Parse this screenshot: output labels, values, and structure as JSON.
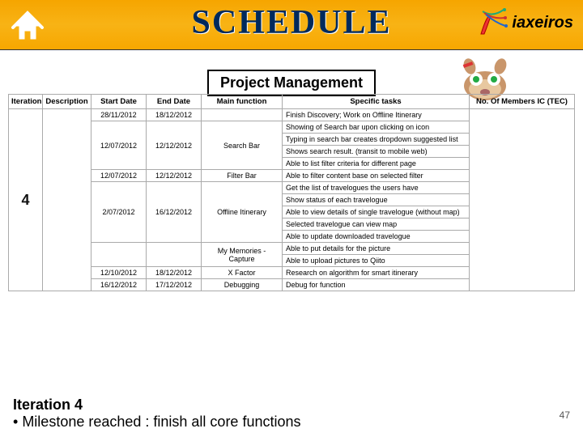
{
  "header": {
    "title": "SCHEDULE",
    "brand": "iaxeiros",
    "home_icon": "home-icon"
  },
  "callout": {
    "label": "Project Management"
  },
  "columns": {
    "iter": "Iteration",
    "desc": "Description",
    "start": "Start Date",
    "end": "End Date",
    "main": "Main function",
    "task": "Specific tasks",
    "mem": "No. Of Members IC (TEC)"
  },
  "iteration_number": "4",
  "rows": [
    {
      "start": "28/11/2012",
      "end": "18/12/2012",
      "main": "",
      "task": "Finish Discovery; Work on Offline Itinerary"
    },
    {
      "start": "12/07/2012",
      "end": "12/12/2012",
      "main": "Search Bar",
      "task": "Showing of Search bar upon clicking on icon",
      "main_span": 4
    },
    {
      "task": "Typing in search bar creates dropdown suggested list"
    },
    {
      "task": "Shows search result. (transit to mobile web)"
    },
    {
      "task": "Able to list filter criteria for different page"
    },
    {
      "start": "12/07/2012",
      "end": "12/12/2012",
      "main": "Filter Bar",
      "task": "Able to filter content base on selected filter",
      "main_span": 1
    },
    {
      "start": "2/07/2012",
      "end": "16/12/2012",
      "main": "Offline Itinerary",
      "task": "Get the list of travelogues the users have",
      "main_span": 5
    },
    {
      "task": "Show status of each travelogue"
    },
    {
      "task": "Able to view details of single travelogue (without map)"
    },
    {
      "task": "Selected travelogue can view map"
    },
    {
      "task": "Able to update downloaded travelogue"
    },
    {
      "start": "",
      "end": "",
      "main": "My Memories - Capture",
      "task": "Able to put details for the picture",
      "main_span": 2
    },
    {
      "task": "Able to upload pictures to Qiito"
    },
    {
      "start": "12/10/2012",
      "end": "18/12/2012",
      "main": "X Factor",
      "task": "Research on algorithm for smart itinerary",
      "main_span": 1
    },
    {
      "start": "16/12/2012",
      "end": "17/12/2012",
      "main": "Debugging",
      "task": "Debug for function",
      "main_span": 1
    }
  ],
  "footer": {
    "heading": "Iteration 4",
    "bullet1": "Milestone reached : finish all core functions"
  },
  "page_number": "47"
}
